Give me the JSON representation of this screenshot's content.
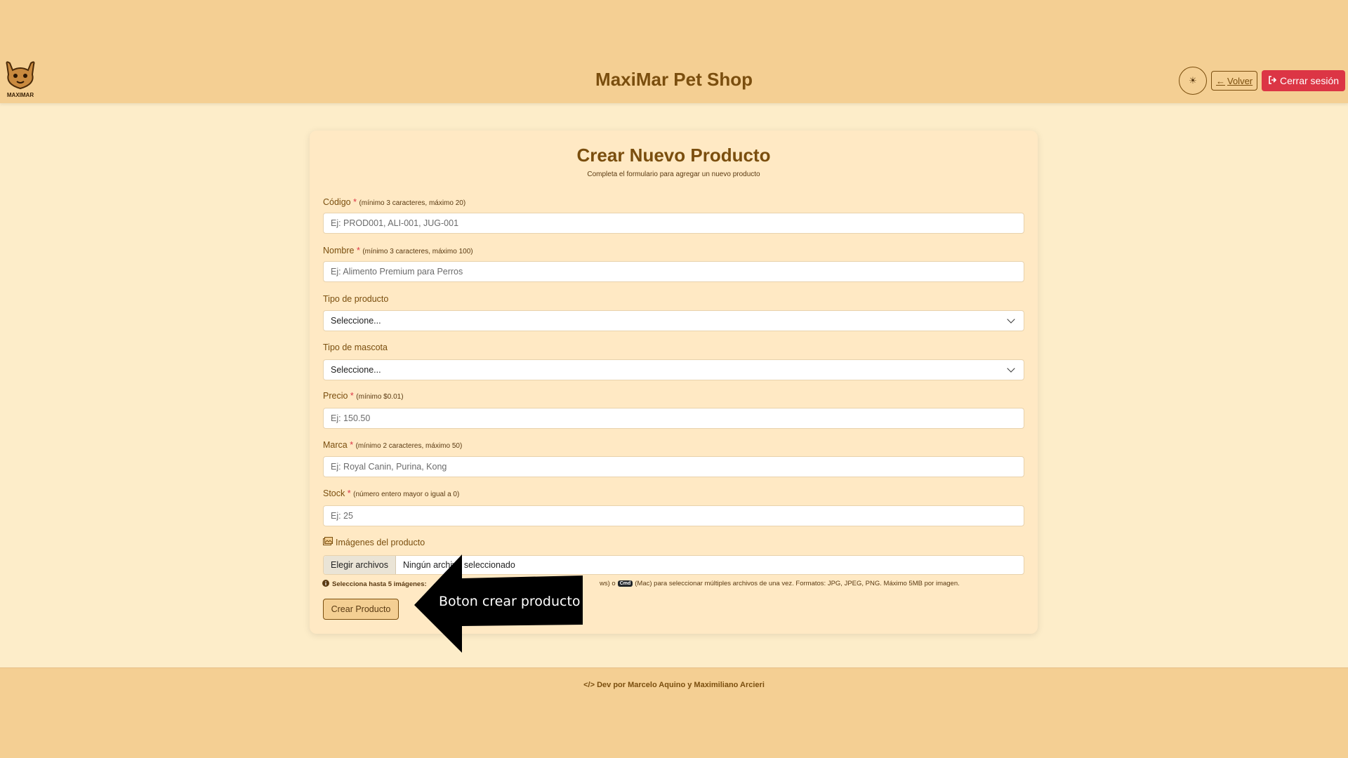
{
  "header": {
    "brand": "MaxiMar Pet Shop",
    "logo_text": "MAXIMAR",
    "back_label": "Volver",
    "logout_label": "Cerrar sesión"
  },
  "form": {
    "title": "Crear Nuevo Producto",
    "subtitle": "Completa el formulario para agregar un nuevo producto",
    "codigo": {
      "label": "Código",
      "required": "*",
      "hint": "(mínimo 3 caracteres, máximo 20)",
      "placeholder": "Ej: PROD001, ALI-001, JUG-001",
      "value": ""
    },
    "nombre": {
      "label": "Nombre",
      "required": "*",
      "hint": "(mínimo 3 caracteres, máximo 100)",
      "placeholder": "Ej: Alimento Premium para Perros",
      "value": ""
    },
    "tipo_producto": {
      "label": "Tipo de producto",
      "selected": "Seleccione..."
    },
    "tipo_mascota": {
      "label": "Tipo de mascota",
      "selected": "Seleccione..."
    },
    "precio": {
      "label": "Precio",
      "required": "*",
      "hint": "(mínimo $0.01)",
      "placeholder": "Ej: 150.50",
      "value": ""
    },
    "marca": {
      "label": "Marca",
      "required": "*",
      "hint": "(mínimo 2 caracteres, máximo 50)",
      "placeholder": "Ej: Royal Canin, Purina, Kong",
      "value": ""
    },
    "stock": {
      "label": "Stock",
      "required": "*",
      "hint": "(número entero mayor o igual a 0)",
      "placeholder": "Ej: 25",
      "value": ""
    },
    "imagenes": {
      "label": "Imágenes del producto",
      "button": "Elegir archivos",
      "status": "Ningún archivo seleccionado",
      "help_bold": "Selecciona hasta 5 imágenes:",
      "help_key": "Cmd",
      "help_tail": "(Mac) para seleccionar múltiples archivos de una vez. Formatos: JPG, JPEG, PNG. Máximo 5MB por imagen.",
      "help_fragment": "ws) o"
    },
    "submit_label": "Crear Producto"
  },
  "annotation": {
    "text": "Boton crear producto"
  },
  "footer": {
    "text": "Dev por Marcelo Aquino y Maximiliano Arcieri"
  },
  "colors": {
    "accent": "#7a4e0e",
    "header_bg": "#f4cf93",
    "page_bg": "#fdedc9",
    "danger": "#dc3545"
  }
}
